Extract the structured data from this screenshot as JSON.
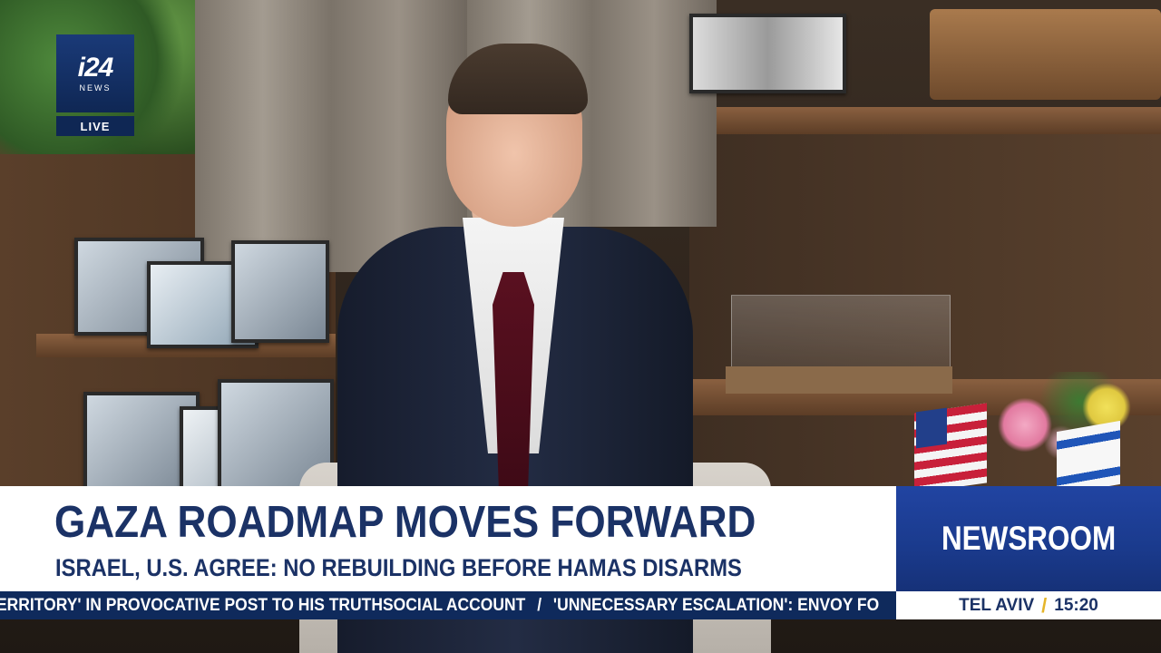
{
  "channel": {
    "logo_text": "i24",
    "logo_subtext": "NEWS",
    "live_label": "LIVE"
  },
  "lower_third": {
    "headline": "GAZA ROADMAP MOVES FORWARD",
    "subheadline": "ISRAEL, U.S. AGREE: NO REBUILDING BEFORE HAMAS DISARMS",
    "program": "NEWSROOM"
  },
  "ticker": {
    "items": [
      "ERRITORY' IN PROVOCATIVE POST TO HIS TRUTHSOCIAL ACCOUNT",
      "'UNNECESSARY ESCALATION': ENVOY FO"
    ],
    "separator": "/"
  },
  "location_clock": {
    "city": "TEL AVIV",
    "separator": "/",
    "time": "15:20"
  },
  "colors": {
    "brand_navy": "#1b3266",
    "ticker_bg": "#0f2a5c",
    "program_blue": "#1f3f9a",
    "accent_gold": "#e5b52a"
  }
}
